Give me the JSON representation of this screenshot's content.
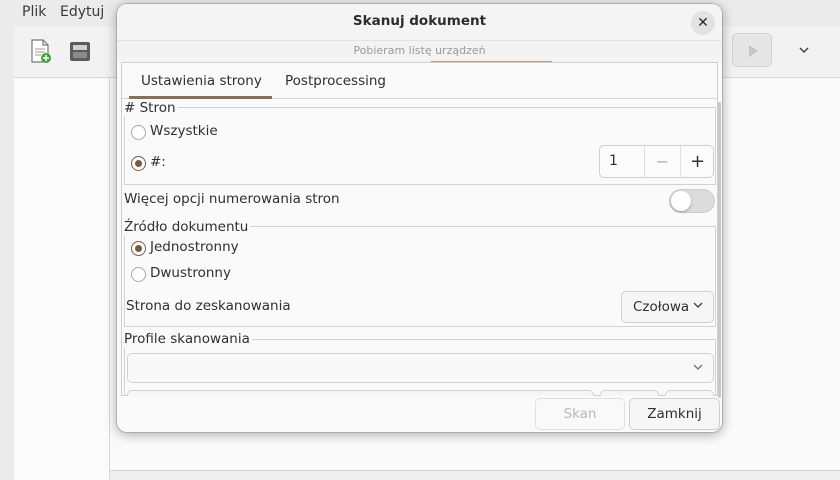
{
  "menu": {
    "items": [
      "Plik",
      "Edytuj"
    ]
  },
  "dialog": {
    "title": "Skanuj dokument",
    "close_glyph": "✕",
    "progress_text": "Pobieram listę urządzeń",
    "progress_fraction": 0.2
  },
  "tabs": [
    {
      "label": "Ustawienia strony",
      "active": true
    },
    {
      "label": "Postprocessing",
      "active": false
    }
  ],
  "pages": {
    "group_label": "# Stron",
    "option_all": "Wszystkie",
    "option_count": "#:",
    "selected": "#:",
    "count_value": "1",
    "minus": "−",
    "plus": "+"
  },
  "more_numbering": {
    "label": "Więcej opcji numerowania stron",
    "enabled": false
  },
  "source": {
    "group_label": "Źródło dokumentu",
    "option_simplex": "Jednostronny",
    "option_duplex": "Dwustronny",
    "selected": "Jednostronny",
    "side_label": "Strona do zeskanowania",
    "side_value": "Czołowa"
  },
  "profiles": {
    "group_label": "Profile skanowania",
    "value": ""
  },
  "buttons": {
    "scan": "Skan",
    "close": "Zamknij"
  },
  "colors": {
    "accent": "#7a5a3e",
    "progress": "#c2946a",
    "tab_indicator": "#8a6e55"
  },
  "icons": [
    "new-document-icon",
    "scanner-icon",
    "chevron-down-icon",
    "play-icon"
  ]
}
